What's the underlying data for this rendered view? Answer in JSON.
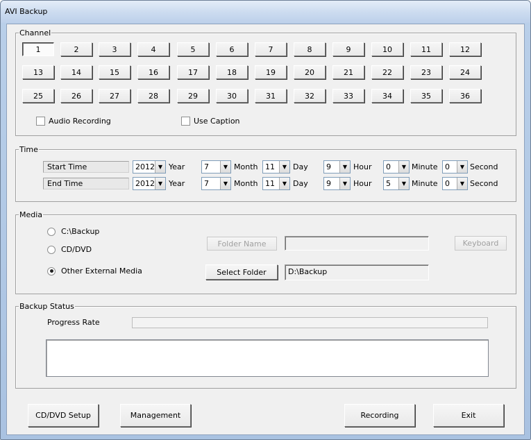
{
  "window": {
    "title": "AVI Backup"
  },
  "channel": {
    "legend": "Channel",
    "buttons": [
      "1",
      "2",
      "3",
      "4",
      "5",
      "6",
      "7",
      "8",
      "9",
      "10",
      "11",
      "12",
      "13",
      "14",
      "15",
      "16",
      "17",
      "18",
      "19",
      "20",
      "21",
      "22",
      "23",
      "24",
      "25",
      "26",
      "27",
      "28",
      "29",
      "30",
      "31",
      "32",
      "33",
      "34",
      "35",
      "36"
    ],
    "selected": "1",
    "audio_recording": {
      "label": "Audio Recording",
      "checked": false
    },
    "use_caption": {
      "label": "Use Caption",
      "checked": false
    }
  },
  "time": {
    "legend": "Time",
    "units": {
      "year": "Year",
      "month": "Month",
      "day": "Day",
      "hour": "Hour",
      "minute": "Minute",
      "second": "Second"
    },
    "start": {
      "label": "Start Time",
      "year": "2012",
      "month": "7",
      "day": "11",
      "hour": "9",
      "minute": "0",
      "second": "0"
    },
    "end": {
      "label": "End Time",
      "year": "2012",
      "month": "7",
      "day": "11",
      "hour": "9",
      "minute": "5",
      "second": "0"
    }
  },
  "media": {
    "legend": "Media",
    "options": [
      "C:\\Backup",
      "CD/DVD",
      "Other External Media"
    ],
    "selected_index": 2,
    "folder_name_label": "Folder Name",
    "folder_name_value": "",
    "keyboard_label": "Keyboard",
    "select_folder_label": "Select Folder",
    "folder_path": "D:\\Backup"
  },
  "backup_status": {
    "legend": "Backup Status",
    "progress_label": "Progress Rate",
    "progress": 0,
    "log": ""
  },
  "footer": {
    "cd_dvd_setup": "CD/DVD Setup",
    "management": "Management",
    "recording": "Recording",
    "exit": "Exit"
  },
  "colors": {
    "frame_blue": "#b9cfe9",
    "dialog_bg": "#f0f0f0"
  }
}
